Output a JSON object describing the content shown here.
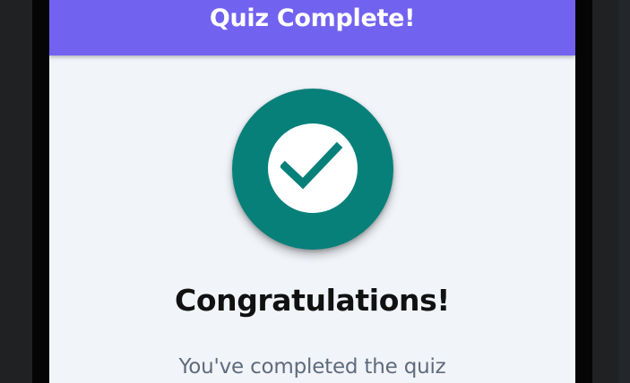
{
  "app_bar": {
    "title": "Quiz Complete!"
  },
  "result": {
    "icon": "check-icon",
    "icon_circle_color": "#07807a",
    "headline": "Congratulations!",
    "message": "You've completed the quiz"
  },
  "colors": {
    "app_bar": "#7162f0",
    "background": "#f1f4f9",
    "subtext": "#5f6b7c"
  }
}
